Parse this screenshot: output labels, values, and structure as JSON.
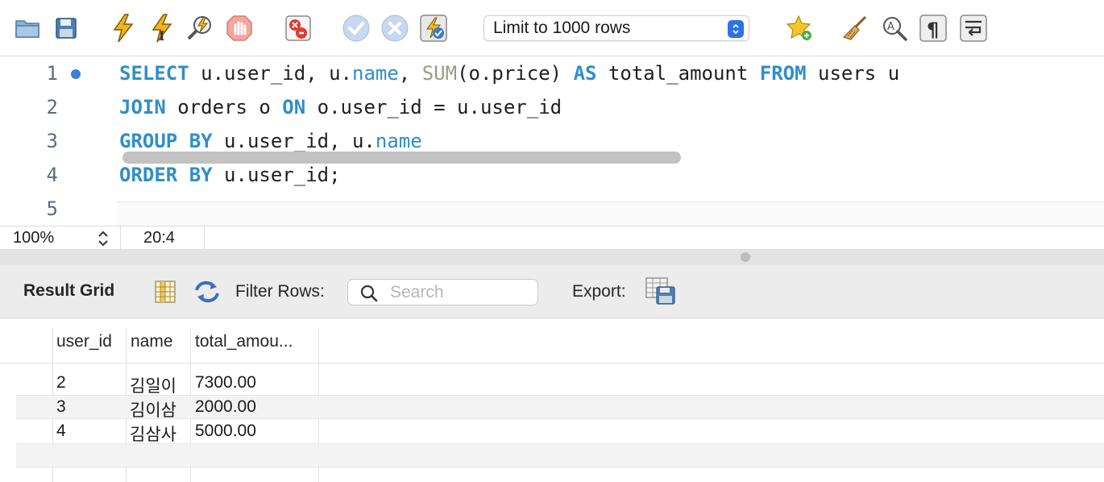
{
  "toolbar": {
    "icons": [
      "folder-icon",
      "save-icon",
      "execute-icon",
      "execute-current-icon",
      "explain-icon",
      "stop-icon",
      "toggle-error-stop-icon",
      "commit-icon",
      "rollback-icon",
      "autocommit-icon",
      "add-snippet-icon",
      "beautify-icon",
      "find-icon",
      "invisible-chars-icon",
      "word-wrap-icon"
    ],
    "limit_select": {
      "selected": "Limit to 1000 rows"
    }
  },
  "editor": {
    "line_numbers": [
      "1",
      "2",
      "3",
      "4",
      "5"
    ],
    "lines": [
      [
        {
          "t": "SELECT",
          "c": "kw"
        },
        {
          "t": " u.user_id, u."
        },
        {
          "t": "name",
          "c": "id"
        },
        {
          "t": ", "
        },
        {
          "t": "SUM",
          "c": "fn"
        },
        {
          "t": "(o.price) "
        },
        {
          "t": "AS",
          "c": "kw"
        },
        {
          "t": " total_amount "
        },
        {
          "t": "FROM",
          "c": "kw"
        },
        {
          "t": " users u"
        }
      ],
      [
        {
          "t": "JOIN",
          "c": "kw"
        },
        {
          "t": " orders o "
        },
        {
          "t": "ON",
          "c": "kw"
        },
        {
          "t": " o.user_id = u.user_id"
        }
      ],
      [
        {
          "t": "GROUP BY",
          "c": "kw"
        },
        {
          "t": " u.user_id, u."
        },
        {
          "t": "name",
          "c": "id"
        }
      ],
      [
        {
          "t": "ORDER BY",
          "c": "kw"
        },
        {
          "t": " u.user_id;"
        }
      ],
      []
    ]
  },
  "status": {
    "zoom": "100%",
    "cursor": "20:4"
  },
  "result": {
    "title": "Result Grid",
    "filter_label": "Filter Rows:",
    "search_placeholder": "Search",
    "export_label": "Export:"
  },
  "grid": {
    "columns": [
      "user_id",
      "name",
      "total_amou..."
    ],
    "rows": [
      [
        "2",
        "김일이",
        "7300.00"
      ],
      [
        "3",
        "김이삼",
        "2000.00"
      ],
      [
        "4",
        "김삼사",
        "5000.00"
      ]
    ]
  },
  "colors": {
    "keyword": "#2f8ec9",
    "function": "#9a9a8a",
    "accent": "#2c72e8",
    "marker": "#3b7fd9"
  }
}
